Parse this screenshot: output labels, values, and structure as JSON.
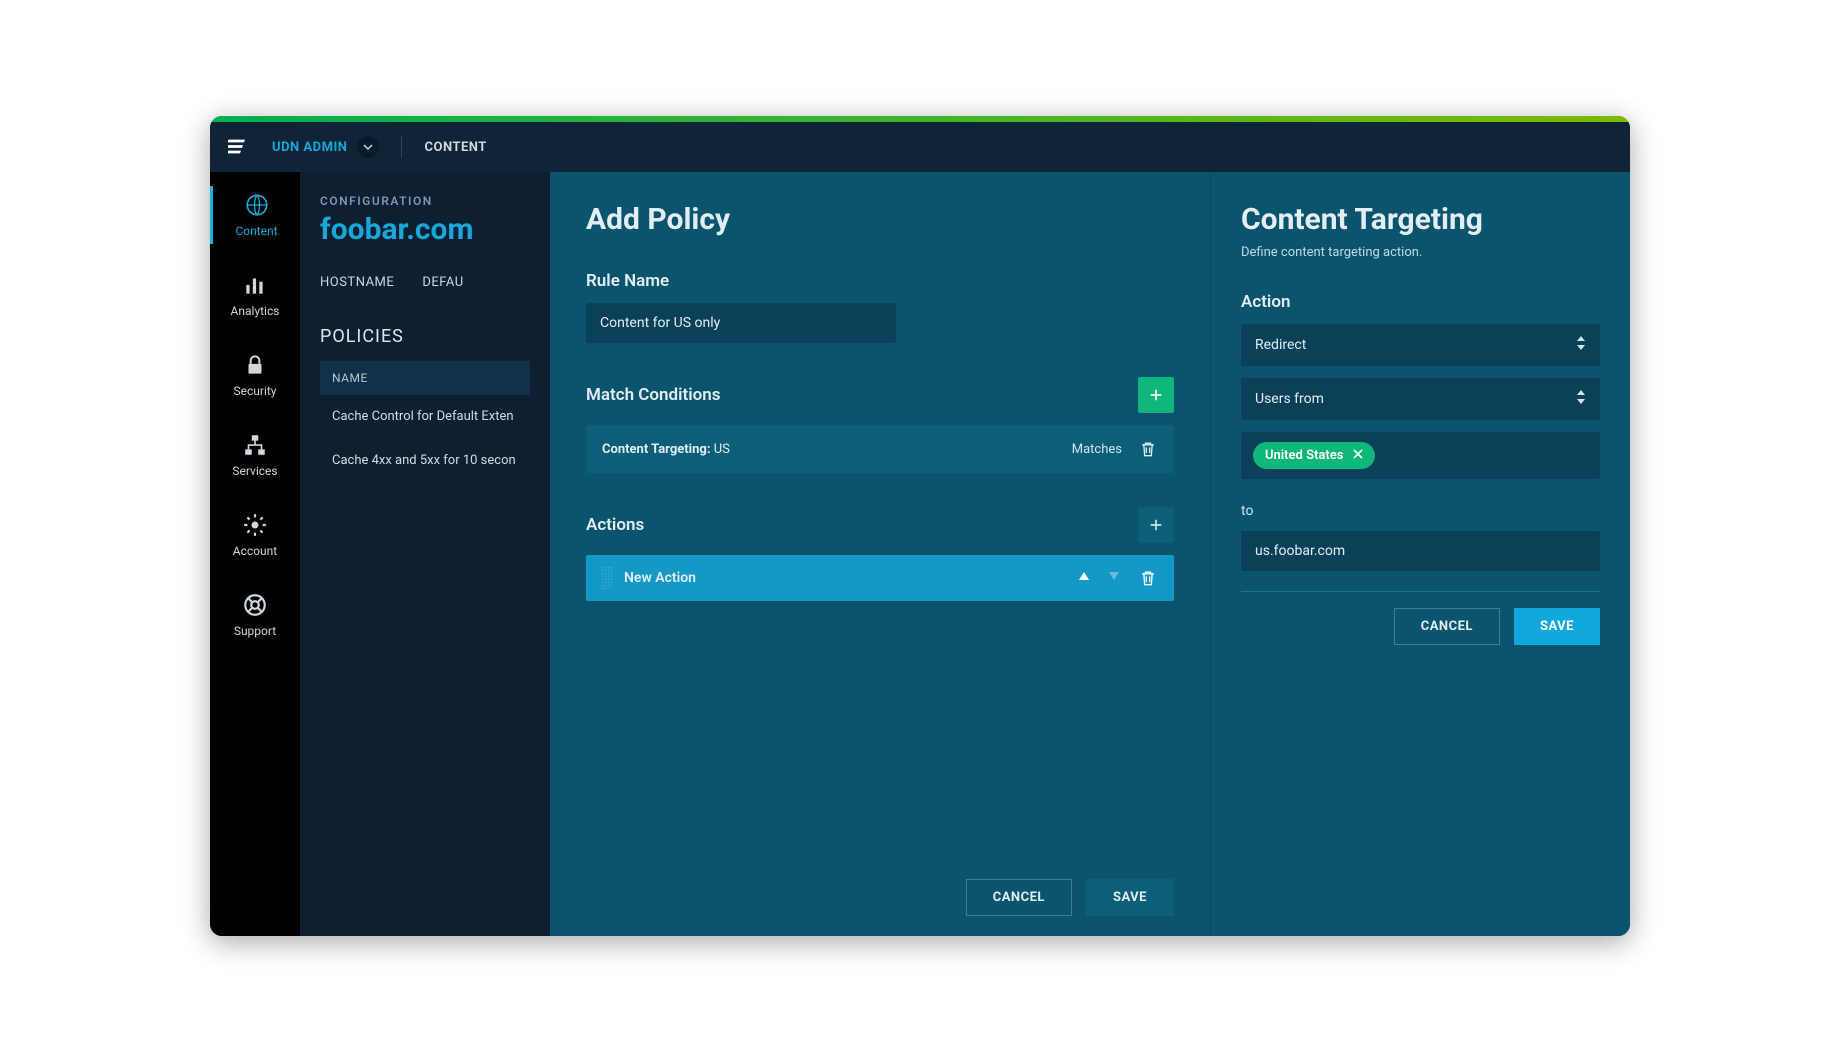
{
  "header": {
    "admin": "UDN ADMIN",
    "crumb": "CONTENT"
  },
  "sidebar": {
    "items": [
      {
        "label": "Content"
      },
      {
        "label": "Analytics"
      },
      {
        "label": "Security"
      },
      {
        "label": "Services"
      },
      {
        "label": "Account"
      },
      {
        "label": "Support"
      }
    ]
  },
  "config": {
    "label": "CONFIGURATION",
    "host": "foobar.com",
    "tabs": {
      "hostname": "HOSTNAME",
      "defaults": "DEFAU"
    },
    "policies_heading": "POLICIES",
    "name_col": "NAME",
    "rows": [
      "Cache Control for Default Exten",
      "Cache 4xx and 5xx for 10 secon"
    ]
  },
  "addPolicy": {
    "title": "Add Policy",
    "rule_name_label": "Rule Name",
    "rule_name_value": "Content for US only",
    "match_label": "Match Conditions",
    "condition": {
      "key": "Content Targeting:",
      "val": " US",
      "matches": "Matches"
    },
    "actions_label": "Actions",
    "new_action": "New Action",
    "cancel": "CANCEL",
    "save": "SAVE"
  },
  "targeting": {
    "title": "Content Targeting",
    "sub": "Define content targeting action.",
    "action_label": "Action",
    "action_value": "Redirect",
    "users_value": "Users from",
    "chip": "United States",
    "to": "to",
    "dest": "us.foobar.com",
    "cancel": "CANCEL",
    "save": "SAVE"
  }
}
